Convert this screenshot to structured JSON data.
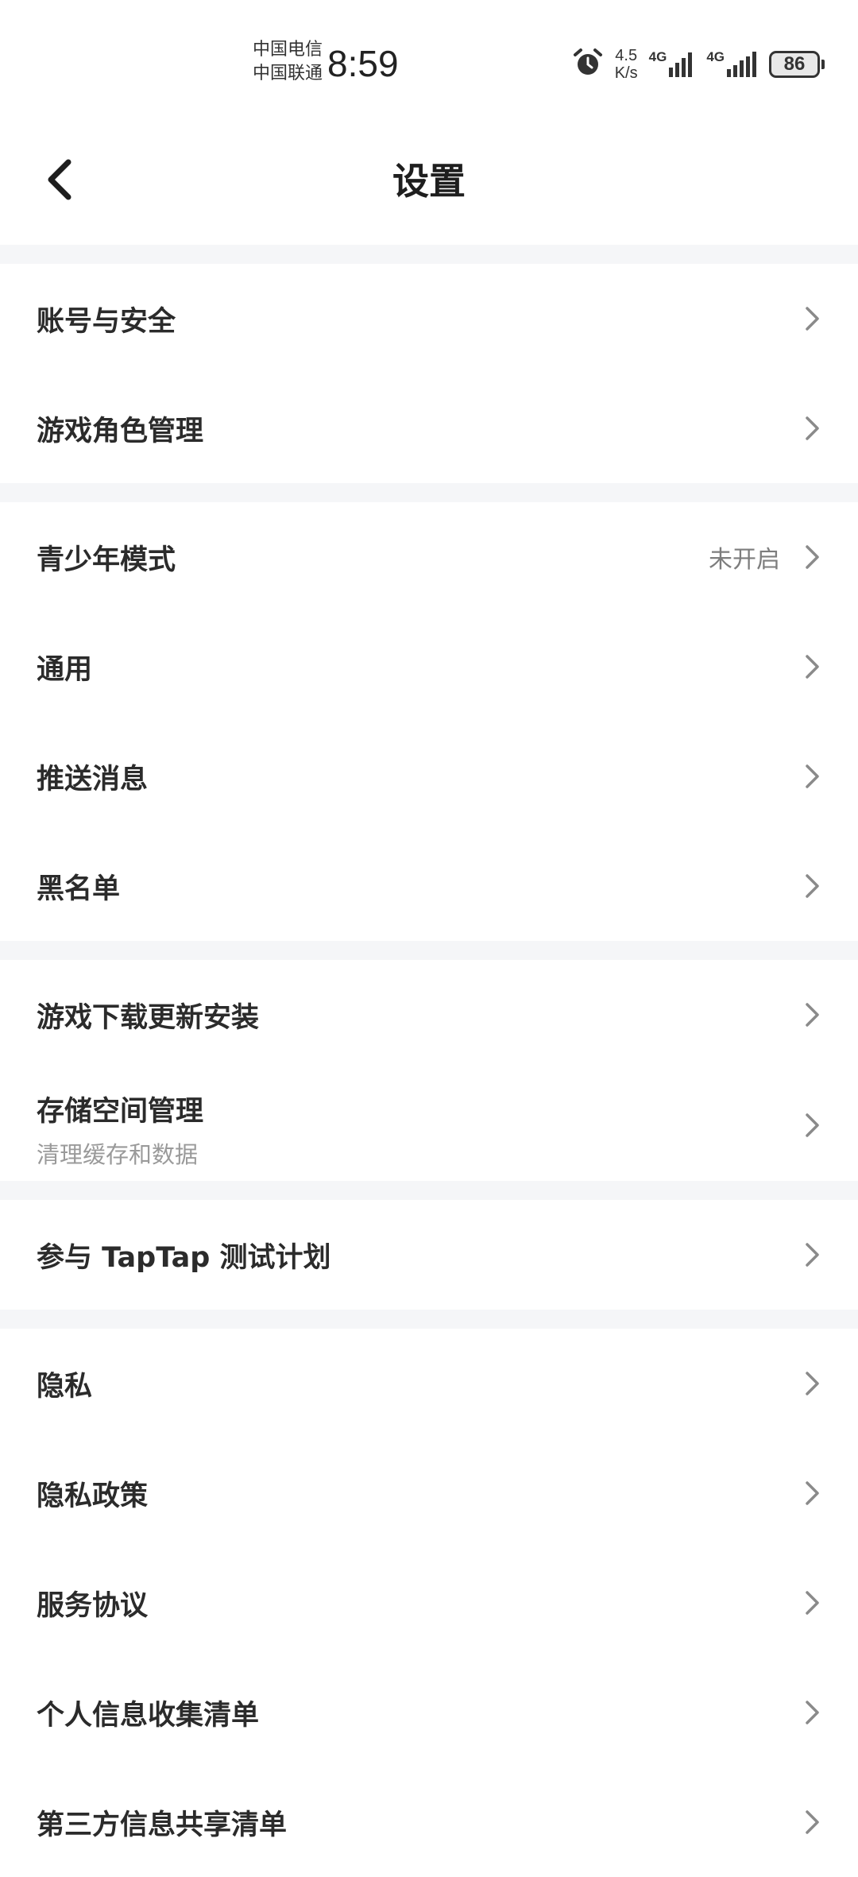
{
  "status_bar": {
    "carrier_1": "中国电信",
    "carrier_2": "中国联通",
    "time": "8:59",
    "speed_value": "4.5",
    "speed_unit": "K/s",
    "net_1": "4G",
    "net_2": "4G",
    "battery": "86"
  },
  "header": {
    "title": "设置"
  },
  "sections": [
    [
      {
        "label": "账号与安全"
      },
      {
        "label": "游戏角色管理"
      }
    ],
    [
      {
        "label": "青少年模式",
        "value": "未开启"
      },
      {
        "label": "通用"
      },
      {
        "label": "推送消息"
      },
      {
        "label": "黑名单"
      }
    ],
    [
      {
        "label": "游戏下载更新安装"
      },
      {
        "label": "存储空间管理",
        "sub": "清理缓存和数据"
      }
    ],
    [
      {
        "label": "参与 TapTap 测试计划"
      }
    ],
    [
      {
        "label": "隐私"
      },
      {
        "label": "隐私政策"
      },
      {
        "label": "服务协议"
      },
      {
        "label": "个人信息收集清单"
      },
      {
        "label": "第三方信息共享清单"
      }
    ]
  ]
}
